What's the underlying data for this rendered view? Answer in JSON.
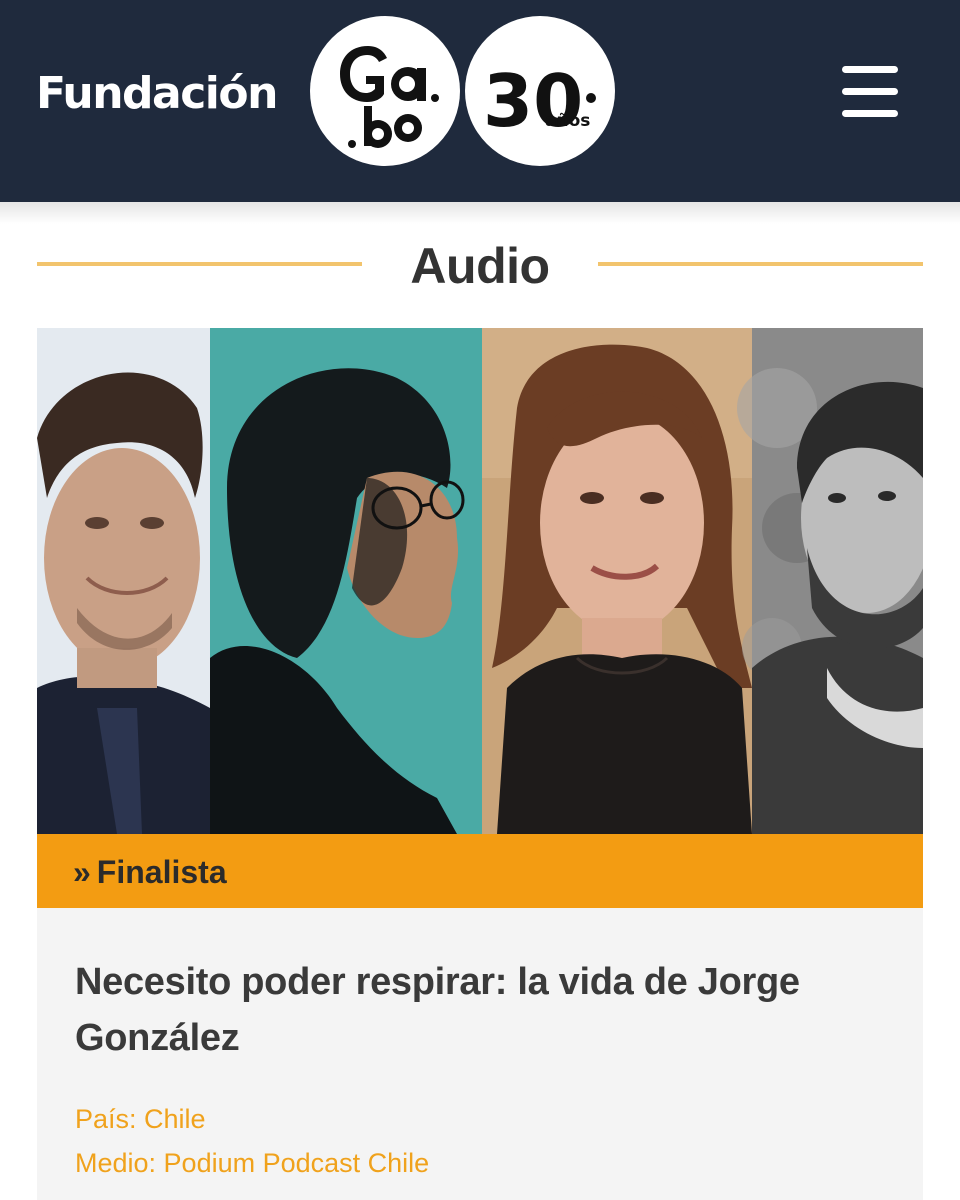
{
  "header": {
    "brand": "Fundación",
    "logo_gabo": "Gabo",
    "logo_years_number": "30",
    "logo_years_label": "años",
    "menu_icon": "hamburger-menu-icon",
    "background": "#1f2a3d"
  },
  "section": {
    "title": "Audio",
    "accent_line_color": "#f2c46d"
  },
  "card": {
    "category": "Finalista",
    "category_prefix": "»",
    "category_color": "#f39c12",
    "title": "Necesito poder respirar: la vida de Jorge González",
    "country": "País: Chile",
    "medium": "Medio: Podium Podcast Chile",
    "meta_color": "#f0a21c"
  }
}
